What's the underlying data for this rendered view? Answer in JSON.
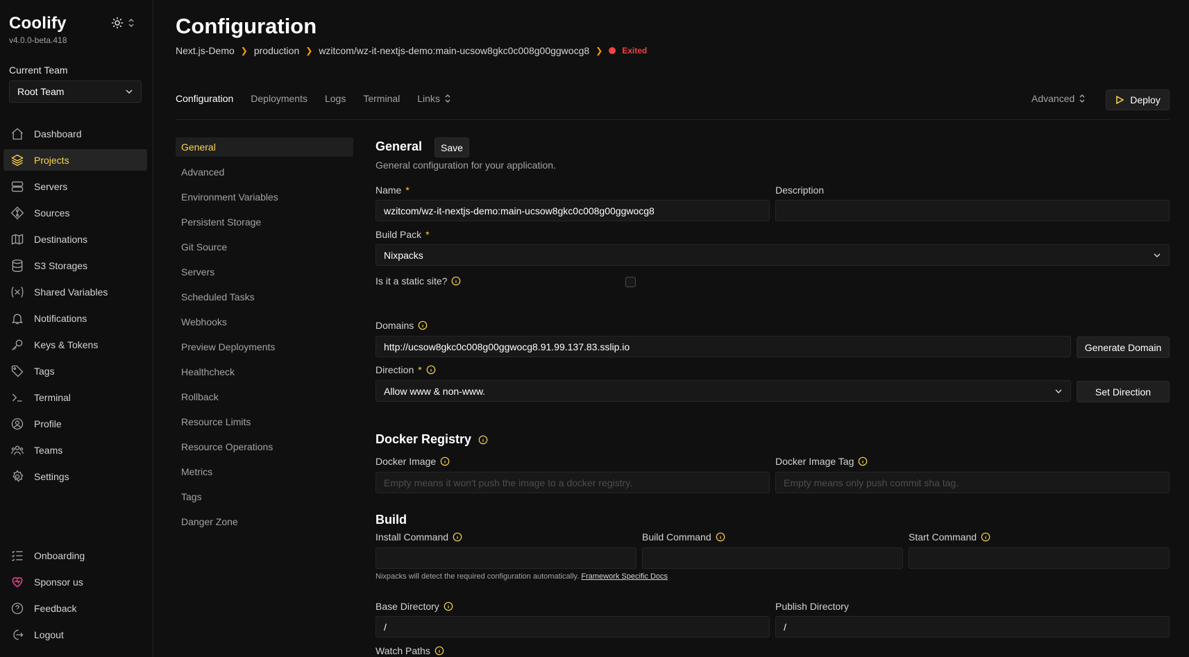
{
  "brand": {
    "title": "Coolify",
    "version": "v4.0.0-beta.418"
  },
  "team": {
    "label": "Current Team",
    "selected": "Root Team"
  },
  "nav": {
    "items": [
      {
        "label": "Dashboard",
        "icon": "home-icon"
      },
      {
        "label": "Projects",
        "icon": "layers-icon"
      },
      {
        "label": "Servers",
        "icon": "server-icon"
      },
      {
        "label": "Sources",
        "icon": "git-icon"
      },
      {
        "label": "Destinations",
        "icon": "destination-icon"
      },
      {
        "label": "S3 Storages",
        "icon": "database-icon"
      },
      {
        "label": "Shared Variables",
        "icon": "variable-icon"
      },
      {
        "label": "Notifications",
        "icon": "bell-icon"
      },
      {
        "label": "Keys & Tokens",
        "icon": "key-icon"
      },
      {
        "label": "Tags",
        "icon": "tag-icon"
      },
      {
        "label": "Terminal",
        "icon": "terminal-icon"
      },
      {
        "label": "Profile",
        "icon": "user-icon"
      },
      {
        "label": "Teams",
        "icon": "users-icon"
      },
      {
        "label": "Settings",
        "icon": "gear-icon"
      }
    ],
    "bottom": [
      {
        "label": "Onboarding",
        "icon": "checklist-icon"
      },
      {
        "label": "Sponsor us",
        "icon": "heart-icon"
      },
      {
        "label": "Feedback",
        "icon": "help-icon"
      },
      {
        "label": "Logout",
        "icon": "logout-icon"
      }
    ]
  },
  "page": {
    "title": "Configuration",
    "breadcrumb": [
      "Next.js-Demo",
      "production",
      "wzitcom/wz-it-nextjs-demo:main-ucsow8gkc0c008g00ggwocg8"
    ],
    "status": "Exited"
  },
  "tabs": {
    "items": [
      "Configuration",
      "Deployments",
      "Logs",
      "Terminal"
    ],
    "links_label": "Links",
    "advanced_label": "Advanced",
    "deploy_label": "Deploy"
  },
  "subnav": {
    "items": [
      "General",
      "Advanced",
      "Environment Variables",
      "Persistent Storage",
      "Git Source",
      "Servers",
      "Scheduled Tasks",
      "Webhooks",
      "Preview Deployments",
      "Healthcheck",
      "Rollback",
      "Resource Limits",
      "Resource Operations",
      "Metrics",
      "Tags",
      "Danger Zone"
    ]
  },
  "general": {
    "title": "General",
    "save_label": "Save",
    "subtitle": "General configuration for your application.",
    "name_label": "Name",
    "name_value": "wzitcom/wz-it-nextjs-demo:main-ucsow8gkc0c008g00ggwocg8",
    "description_label": "Description",
    "description_value": "",
    "buildpack_label": "Build Pack",
    "buildpack_value": "Nixpacks",
    "static_label": "Is it a static site?",
    "static_checked": false,
    "domains_label": "Domains",
    "domains_value": "http://ucsow8gkc0c008g00ggwocg8.91.99.137.83.sslip.io",
    "generate_domain_label": "Generate Domain",
    "direction_label": "Direction",
    "direction_value": "Allow www & non-www.",
    "set_direction_label": "Set Direction",
    "required_mark": "*"
  },
  "docker": {
    "title": "Docker Registry",
    "image_label": "Docker Image",
    "image_placeholder": "Empty means it won't push the image to a docker registry.",
    "tag_label": "Docker Image Tag",
    "tag_placeholder": "Empty means only push commit sha tag."
  },
  "build": {
    "title": "Build",
    "install_label": "Install Command",
    "build_label": "Build Command",
    "start_label": "Start Command",
    "helper_text": "Nixpacks will detect the required configuration automatically.",
    "helper_link": "Framework Specific Docs",
    "base_dir_label": "Base Directory",
    "base_dir_value": "/",
    "publish_dir_label": "Publish Directory",
    "publish_dir_value": "/",
    "watch_paths_label": "Watch Paths"
  },
  "colors": {
    "accent": "#fcd34d",
    "status_exited": "#ef4444",
    "sponsor": "#ec4899"
  }
}
